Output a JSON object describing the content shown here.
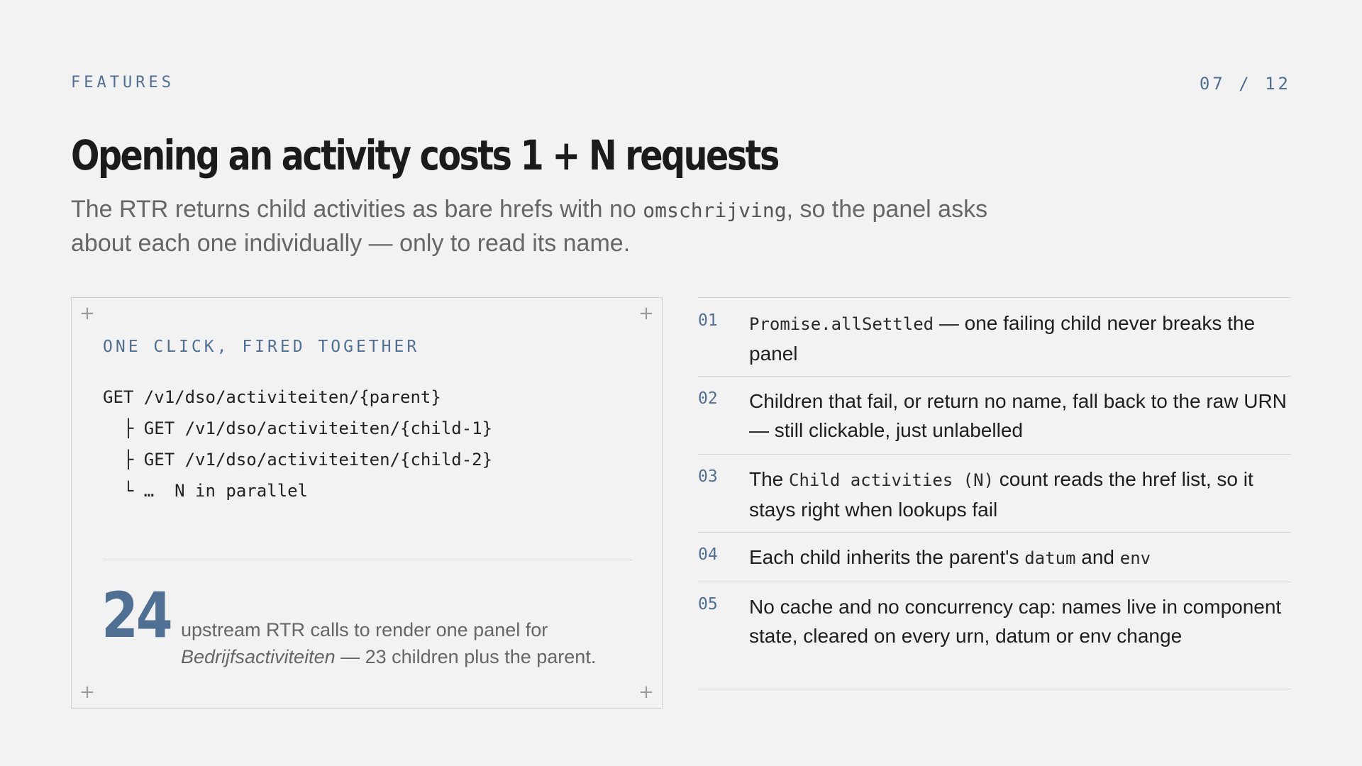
{
  "header": {
    "eyebrow": "FEATURES",
    "pager": "07 / 12"
  },
  "title": "Opening an activity costs 1 + N requests",
  "subtitle": {
    "part1": "The RTR returns child activities as bare hrefs with no ",
    "code": "omschrijving",
    "part2": ", so the panel asks about each one individually — only to read its name."
  },
  "panel": {
    "label": "ONE CLICK, FIRED TOGETHER",
    "code_lines": [
      "GET /v1/dso/activiteiten/{parent}",
      "  ├ GET /v1/dso/activiteiten/{child-1}",
      "  ├ GET /v1/dso/activiteiten/{child-2}",
      "  └ …  N in parallel"
    ],
    "stat": {
      "value": "24",
      "caption_part1": "upstream RTR calls to render one panel for ",
      "caption_em": "Bedrijfsactiviteiten",
      "caption_part2": " — 23 children plus the parent."
    }
  },
  "features": [
    {
      "num": "01",
      "code1": "Promise.allSettled",
      "text1": " — one failing child never breaks the panel"
    },
    {
      "num": "02",
      "text1": "Children that fail, or return no name, fall back to the raw URN — still clickable, just unlabelled"
    },
    {
      "num": "03",
      "text1": "The ",
      "code1": "Child activities (N)",
      "text2": " count reads the href list, so it stays right when lookups fail"
    },
    {
      "num": "04",
      "text1": "Each child inherits the parent's ",
      "code1": "datum",
      "text2": " and ",
      "code2": "env"
    },
    {
      "num": "05",
      "text1": "No cache and no concurrency cap: names live in component state, cleared on every urn, datum or env change"
    }
  ]
}
